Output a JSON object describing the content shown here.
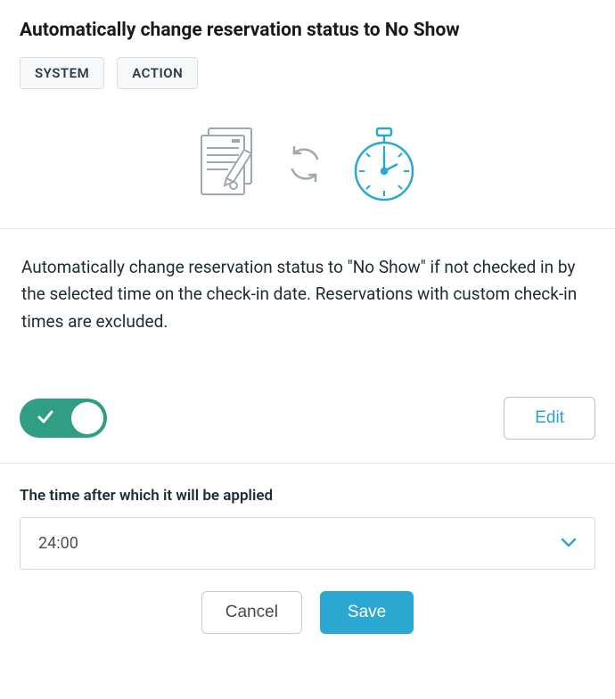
{
  "header": {
    "title": "Automatically change reservation status to No Show",
    "tags": {
      "system": "SYSTEM",
      "action": "ACTION"
    }
  },
  "banner": {
    "icons": {
      "doc": "document-pencil-icon",
      "sync": "sync-icon",
      "clock": "stopwatch-icon"
    },
    "accent": "#2aa8d1",
    "neutral": "#9fa8ae"
  },
  "description": "Automatically change reservation status to \"No Show\" if not checked in by the selected time on the check-in date. Reservations with custom check-in times are excluded.",
  "toggle": {
    "enabled": true
  },
  "edit_label": "Edit",
  "field": {
    "label": "The time after which it will be applied",
    "value": "24:00"
  },
  "actions": {
    "cancel": "Cancel",
    "save": "Save"
  },
  "colors": {
    "toggle_on": "#2f9e82",
    "primary": "#2aa8d1"
  }
}
